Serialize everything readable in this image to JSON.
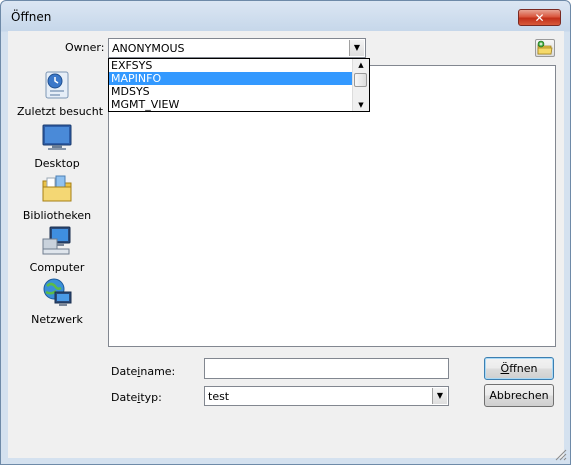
{
  "window": {
    "title": "Öffnen",
    "close_glyph": "✕"
  },
  "owner": {
    "label": "Owner:",
    "value": "ANONYMOUS",
    "arrow": "▼"
  },
  "owner_list": {
    "items": [
      "EXFSYS",
      "MAPINFO",
      "MDSYS",
      "MGMT_VIEW"
    ],
    "selected_index": 1
  },
  "places": [
    {
      "label": "Zuletzt besucht",
      "icon": "recent-places-icon"
    },
    {
      "label": "Desktop",
      "icon": "desktop-icon"
    },
    {
      "label": "Bibliotheken",
      "icon": "libraries-icon"
    },
    {
      "label": "Computer",
      "icon": "computer-icon"
    },
    {
      "label": "Netzwerk",
      "icon": "network-icon"
    }
  ],
  "filename": {
    "label_pre": "Date",
    "label_u": "i",
    "label_post": "name:",
    "value": ""
  },
  "filetype": {
    "label_pre": "Date",
    "label_u": "i",
    "label_post": "typ:",
    "value": "test",
    "arrow": "▼"
  },
  "buttons": {
    "open_pre": "",
    "open_u": "Ö",
    "open_post": "ffnen",
    "cancel": "Abbrechen"
  },
  "colors": {
    "selection": "#3399ff",
    "close_button": "#c2301a",
    "window_frame": "#c6d7ea"
  }
}
